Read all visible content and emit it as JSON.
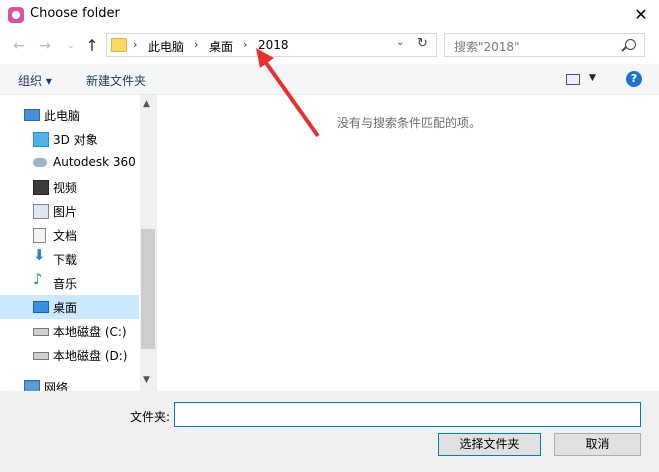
{
  "window": {
    "title": "Choose folder"
  },
  "nav": {
    "back": "←",
    "forward": "→",
    "recent": "⌄",
    "up": "↑"
  },
  "address": {
    "crumbs": [
      "此电脑",
      "桌面",
      "2018"
    ],
    "sep": "›",
    "dropdown": "⌄",
    "refresh": "↻"
  },
  "search": {
    "placeholder": "搜索\"2018\""
  },
  "toolbar": {
    "organize": "组织 ▾",
    "new_folder": "新建文件夹",
    "view_arrow": "▼",
    "help": "?"
  },
  "sidebar": {
    "items": [
      {
        "label": "此电脑",
        "icon": "computer-icon"
      },
      {
        "label": "3D 对象",
        "icon": "cube-icon"
      },
      {
        "label": "Autodesk 360",
        "icon": "cloud-icon"
      },
      {
        "label": "视频",
        "icon": "video-icon"
      },
      {
        "label": "图片",
        "icon": "picture-icon"
      },
      {
        "label": "文档",
        "icon": "document-icon"
      },
      {
        "label": "下载",
        "icon": "download-icon"
      },
      {
        "label": "音乐",
        "icon": "music-icon"
      },
      {
        "label": "桌面",
        "icon": "desktop-icon",
        "selected": true
      },
      {
        "label": "本地磁盘 (C:)",
        "icon": "drive-c-icon"
      },
      {
        "label": "本地磁盘 (D:)",
        "icon": "drive-d-icon"
      },
      {
        "label": "网络",
        "icon": "network-icon"
      }
    ]
  },
  "main": {
    "empty_message": "没有与搜索条件匹配的项。"
  },
  "bottom": {
    "folder_label": "文件夹:",
    "folder_value": "",
    "select_button": "选择文件夹",
    "cancel_button": "取消"
  },
  "colors": {
    "accent": "#0078d7",
    "selection": "#cce8ff",
    "annotation_arrow": "#e8312f"
  }
}
